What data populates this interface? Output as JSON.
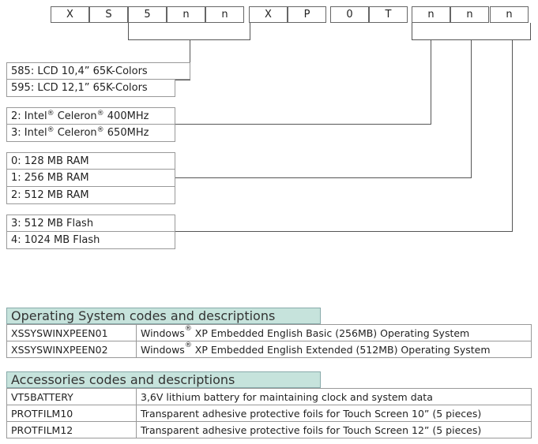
{
  "code_cells": [
    "X",
    "S",
    "5",
    "n",
    "n",
    "X",
    "P",
    "0",
    "T",
    "n",
    "n",
    "n"
  ],
  "display_options": [
    "585: LCD 10,4” 65K-Colors",
    "595: LCD 12,1” 65K-Colors"
  ],
  "cpu_options": [
    {
      "prefix": "2: Intel",
      "mid": " Celeron",
      "suffix": " 400MHz",
      "reg": "®"
    },
    {
      "prefix": "3: Intel",
      "mid": " Celeron",
      "suffix": " 650MHz",
      "reg": "®"
    }
  ],
  "ram_options": [
    "0: 128 MB RAM",
    "1: 256 MB RAM",
    "2: 512 MB RAM"
  ],
  "flash_options": [
    "3: 512 MB Flash",
    "4: 1024 MB Flash"
  ],
  "os_table": {
    "title": "Operating System codes and descriptions",
    "rows": [
      {
        "code": "XSSYSWINXPEEN01",
        "desc_prefix": "Windows",
        "reg": "®",
        "desc_suffix": " XP Embedded English Basic (256MB) Operating System"
      },
      {
        "code": "XSSYSWINXPEEN02",
        "desc_prefix": "Windows",
        "reg": "®",
        "desc_suffix": " XP Embedded English Extended (512MB) Operating System"
      }
    ]
  },
  "accessories_table": {
    "title": "Accessories codes and descriptions",
    "rows": [
      {
        "code": "VT5BATTERY",
        "desc": "3,6V lithium battery for maintaining clock and system data"
      },
      {
        "code": "PROTFILM10",
        "desc": "Transparent adhesive protective foils for Touch Screen 10” (5 pieces)"
      },
      {
        "code": "PROTFILM12",
        "desc": "Transparent adhesive protective foils for Touch Screen 12” (5 pieces)"
      }
    ]
  }
}
